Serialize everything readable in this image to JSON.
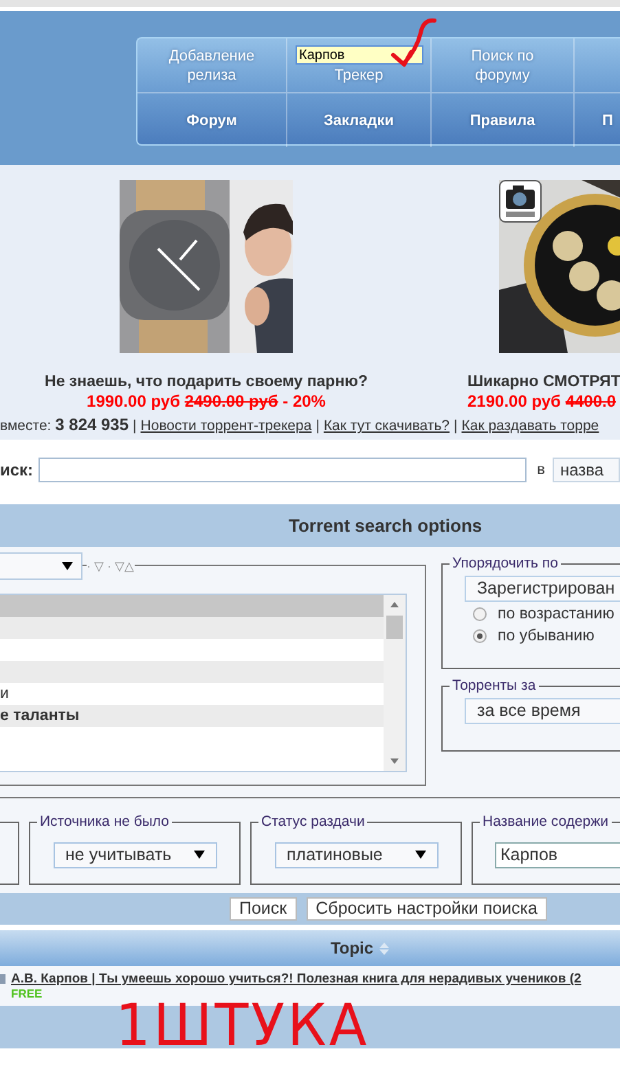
{
  "nav": {
    "top": [
      {
        "kind": "link",
        "label": "Добавление релиза"
      },
      {
        "kind": "search",
        "value": "Карпов",
        "label": "Трекер"
      },
      {
        "kind": "link",
        "label": "Поиск по форуму"
      },
      {
        "kind": "blank"
      }
    ],
    "bottom": [
      "Форум",
      "Закладки",
      "Правила",
      "П"
    ]
  },
  "ads": [
    {
      "title": "Не знаешь, что подарить своему парню?",
      "price": "1990.00 руб",
      "old_price": "2490.00 руб",
      "discount": "- 20%",
      "badge": false
    },
    {
      "title": "Шикарно СМОТРЯТ",
      "price": "2190.00 руб",
      "old_price": "4400.0",
      "badge": true
    }
  ],
  "stats": {
    "label": "вместе:",
    "count": "3 824 935",
    "separator": "|",
    "links": [
      "Новости торрент-трекера",
      "Как тут скачивать?",
      "Как раздавать торре"
    ]
  },
  "search": {
    "label": "иск:",
    "in_label": "в",
    "scope": "назва"
  },
  "options": {
    "title": "Torrent search options",
    "sort_marks": "· ▽ · ▽△",
    "forum_rows": [
      {
        "kind": "forum",
        "selected": true
      },
      {
        "kind": "category",
        "selected": false
      },
      {
        "kind": "forum",
        "selected": false
      },
      {
        "kind": "category",
        "selected": false
      },
      {
        "kind": "forum",
        "selected": false,
        "text": "и"
      },
      {
        "kind": "category",
        "selected": false,
        "text": "е таланты"
      },
      {
        "kind": "forum",
        "selected": false
      },
      {
        "kind": "forum",
        "selected": false
      }
    ],
    "sort": {
      "legend": "Упорядочить по",
      "value": "Зарегистрирован",
      "options": [
        {
          "label": "по возрастанию",
          "selected": false
        },
        {
          "label": "по убыванию",
          "selected": true
        }
      ]
    },
    "period": {
      "legend": "Торренты за",
      "value": "за все время"
    },
    "filters": [
      {
        "kind": "empty"
      },
      {
        "kind": "select",
        "legend": "Источника не было",
        "value": "не учитывать"
      },
      {
        "kind": "select",
        "legend": "Статус раздачи",
        "value": "платиновые"
      },
      {
        "kind": "input",
        "legend": "Название содержи",
        "value": "Карпов"
      }
    ],
    "buttons": [
      "Поиск",
      "Сбросить настройки поиска"
    ]
  },
  "results": {
    "column": "Topic",
    "rows": [
      {
        "title": "А.В. Карпов | Ты умеешь хорошо учиться?! Полезная книга для нерадивых учеников (2",
        "tag": "FREE"
      }
    ]
  },
  "annotation": {
    "text": "1ШТУКА"
  }
}
